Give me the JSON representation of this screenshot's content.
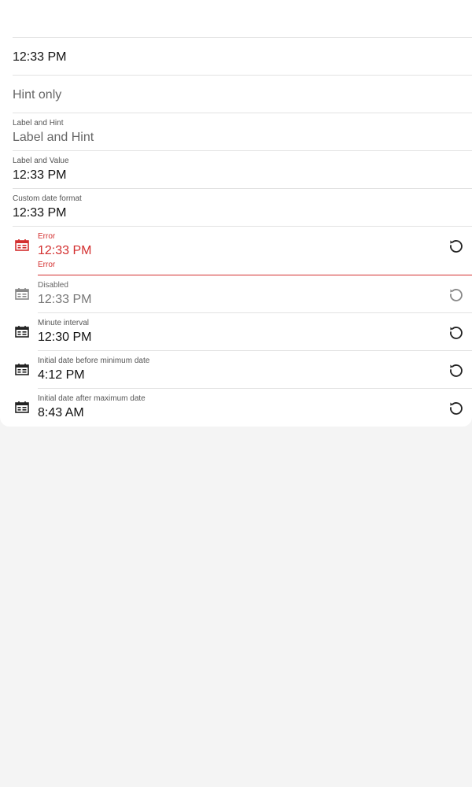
{
  "fields": {
    "empty": {
      "value": ""
    },
    "plain": {
      "value": "12:33 PM"
    },
    "hint_only": {
      "hint": "Hint only"
    },
    "label_and_hint": {
      "label": "Label and Hint",
      "hint": "Label and Hint"
    },
    "label_and_value": {
      "label": "Label and Value",
      "value": "12:33 PM"
    },
    "custom_format": {
      "label": "Custom date format",
      "value": "12:33 PM"
    },
    "error": {
      "label": "Error",
      "value": "12:33 PM",
      "helper": "Error"
    },
    "disabled": {
      "label": "Disabled",
      "value": "12:33 PM"
    },
    "minute_interval": {
      "label": "Minute interval",
      "value": "12:30 PM"
    },
    "before_min": {
      "label": "Initial date before minimum date",
      "value": "4:12 PM"
    },
    "after_max": {
      "label": "Initial date after maximum date",
      "value": "8:43 AM"
    }
  },
  "icons": {
    "calendar": "calendar-icon",
    "reset": "reset-icon"
  },
  "colors": {
    "error": "#d32f2f",
    "disabled": "#777777",
    "text": "#111111",
    "page_background": "#f4f4f4",
    "card_background": "#ffffff"
  }
}
